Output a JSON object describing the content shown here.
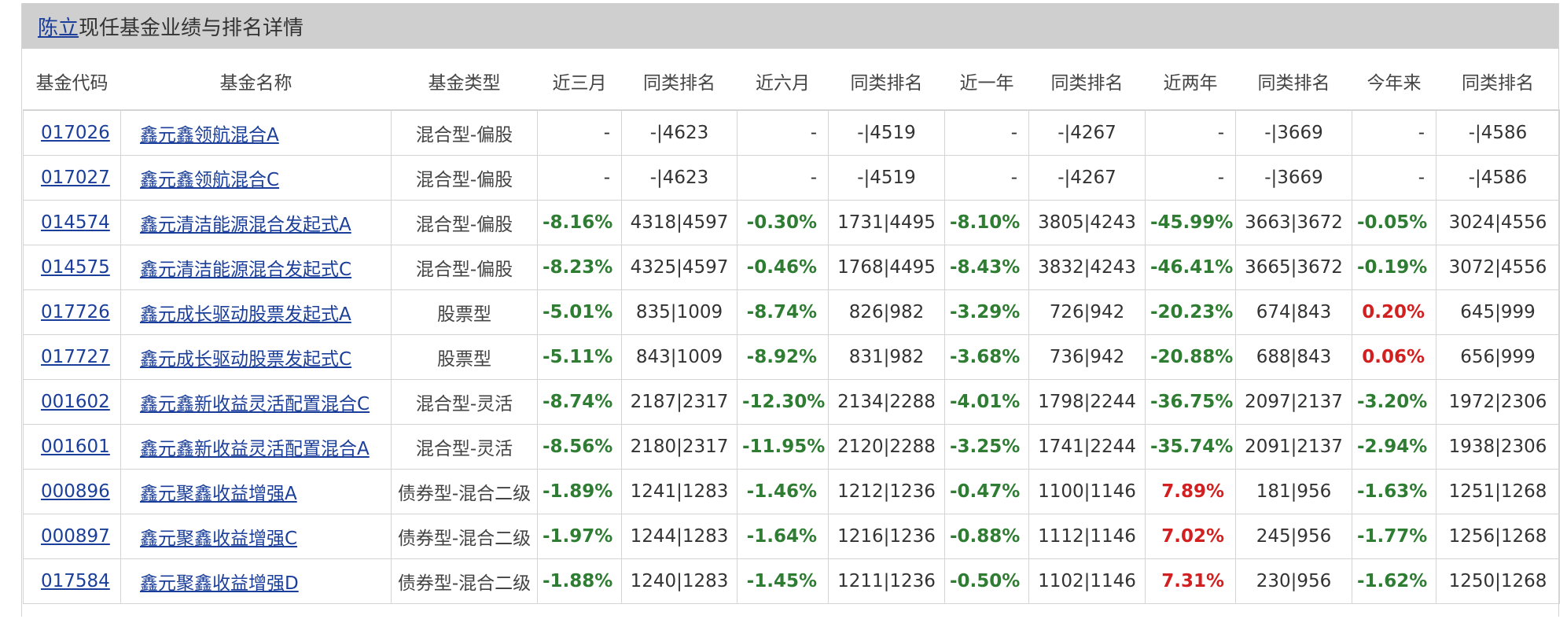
{
  "title": {
    "link": "陈立",
    "rest": "现任基金业绩与排名详情"
  },
  "headers": [
    "基金代码",
    "基金名称",
    "基金类型",
    "近三月",
    "同类排名",
    "近六月",
    "同类排名",
    "近一年",
    "同类排名",
    "近两年",
    "同类排名",
    "今年来",
    "同类排名"
  ],
  "colors": {
    "positive": "#d21f1f",
    "negative": "#2e7d32",
    "link": "#1a3e9a"
  },
  "rows": [
    {
      "code": "017026",
      "name": "鑫元鑫领航混合A",
      "type": "混合型-偏股",
      "m3": "-",
      "m3_rank": "-|4623",
      "m6": "-",
      "m6_rank": "-|4519",
      "y1": "-",
      "y1_rank": "-|4267",
      "y2": "-",
      "y2_rank": "-|3669",
      "ytd": "-",
      "ytd_rank": "-|4586"
    },
    {
      "code": "017027",
      "name": "鑫元鑫领航混合C",
      "type": "混合型-偏股",
      "m3": "-",
      "m3_rank": "-|4623",
      "m6": "-",
      "m6_rank": "-|4519",
      "y1": "-",
      "y1_rank": "-|4267",
      "y2": "-",
      "y2_rank": "-|3669",
      "ytd": "-",
      "ytd_rank": "-|4586"
    },
    {
      "code": "014574",
      "name": "鑫元清洁能源混合发起式A",
      "type": "混合型-偏股",
      "m3": "-8.16%",
      "m3_rank": "4318|4597",
      "m6": "-0.30%",
      "m6_rank": "1731|4495",
      "y1": "-8.10%",
      "y1_rank": "3805|4243",
      "y2": "-45.99%",
      "y2_rank": "3663|3672",
      "ytd": "-0.05%",
      "ytd_rank": "3024|4556"
    },
    {
      "code": "014575",
      "name": "鑫元清洁能源混合发起式C",
      "type": "混合型-偏股",
      "m3": "-8.23%",
      "m3_rank": "4325|4597",
      "m6": "-0.46%",
      "m6_rank": "1768|4495",
      "y1": "-8.43%",
      "y1_rank": "3832|4243",
      "y2": "-46.41%",
      "y2_rank": "3665|3672",
      "ytd": "-0.19%",
      "ytd_rank": "3072|4556"
    },
    {
      "code": "017726",
      "name": "鑫元成长驱动股票发起式A",
      "type": "股票型",
      "m3": "-5.01%",
      "m3_rank": "835|1009",
      "m6": "-8.74%",
      "m6_rank": "826|982",
      "y1": "-3.29%",
      "y1_rank": "726|942",
      "y2": "-20.23%",
      "y2_rank": "674|843",
      "ytd": "0.20%",
      "ytd_rank": "645|999"
    },
    {
      "code": "017727",
      "name": "鑫元成长驱动股票发起式C",
      "type": "股票型",
      "m3": "-5.11%",
      "m3_rank": "843|1009",
      "m6": "-8.92%",
      "m6_rank": "831|982",
      "y1": "-3.68%",
      "y1_rank": "736|942",
      "y2": "-20.88%",
      "y2_rank": "688|843",
      "ytd": "0.06%",
      "ytd_rank": "656|999"
    },
    {
      "code": "001602",
      "name": "鑫元鑫新收益灵活配置混合C",
      "type": "混合型-灵活",
      "m3": "-8.74%",
      "m3_rank": "2187|2317",
      "m6": "-12.30%",
      "m6_rank": "2134|2288",
      "y1": "-4.01%",
      "y1_rank": "1798|2244",
      "y2": "-36.75%",
      "y2_rank": "2097|2137",
      "ytd": "-3.20%",
      "ytd_rank": "1972|2306"
    },
    {
      "code": "001601",
      "name": "鑫元鑫新收益灵活配置混合A",
      "type": "混合型-灵活",
      "m3": "-8.56%",
      "m3_rank": "2180|2317",
      "m6": "-11.95%",
      "m6_rank": "2120|2288",
      "y1": "-3.25%",
      "y1_rank": "1741|2244",
      "y2": "-35.74%",
      "y2_rank": "2091|2137",
      "ytd": "-2.94%",
      "ytd_rank": "1938|2306"
    },
    {
      "code": "000896",
      "name": "鑫元聚鑫收益增强A",
      "type": "债券型-混合二级",
      "m3": "-1.89%",
      "m3_rank": "1241|1283",
      "m6": "-1.46%",
      "m6_rank": "1212|1236",
      "y1": "-0.47%",
      "y1_rank": "1100|1146",
      "y2": "7.89%",
      "y2_rank": "181|956",
      "ytd": "-1.63%",
      "ytd_rank": "1251|1268"
    },
    {
      "code": "000897",
      "name": "鑫元聚鑫收益增强C",
      "type": "债券型-混合二级",
      "m3": "-1.97%",
      "m3_rank": "1244|1283",
      "m6": "-1.64%",
      "m6_rank": "1216|1236",
      "y1": "-0.88%",
      "y1_rank": "1112|1146",
      "y2": "7.02%",
      "y2_rank": "245|956",
      "ytd": "-1.77%",
      "ytd_rank": "1256|1268"
    },
    {
      "code": "017584",
      "name": "鑫元聚鑫收益增强D",
      "type": "债券型-混合二级",
      "m3": "-1.88%",
      "m3_rank": "1240|1283",
      "m6": "-1.45%",
      "m6_rank": "1211|1236",
      "y1": "-0.50%",
      "y1_rank": "1102|1146",
      "y2": "7.31%",
      "y2_rank": "230|956",
      "ytd": "-1.62%",
      "ytd_rank": "1250|1268"
    }
  ]
}
